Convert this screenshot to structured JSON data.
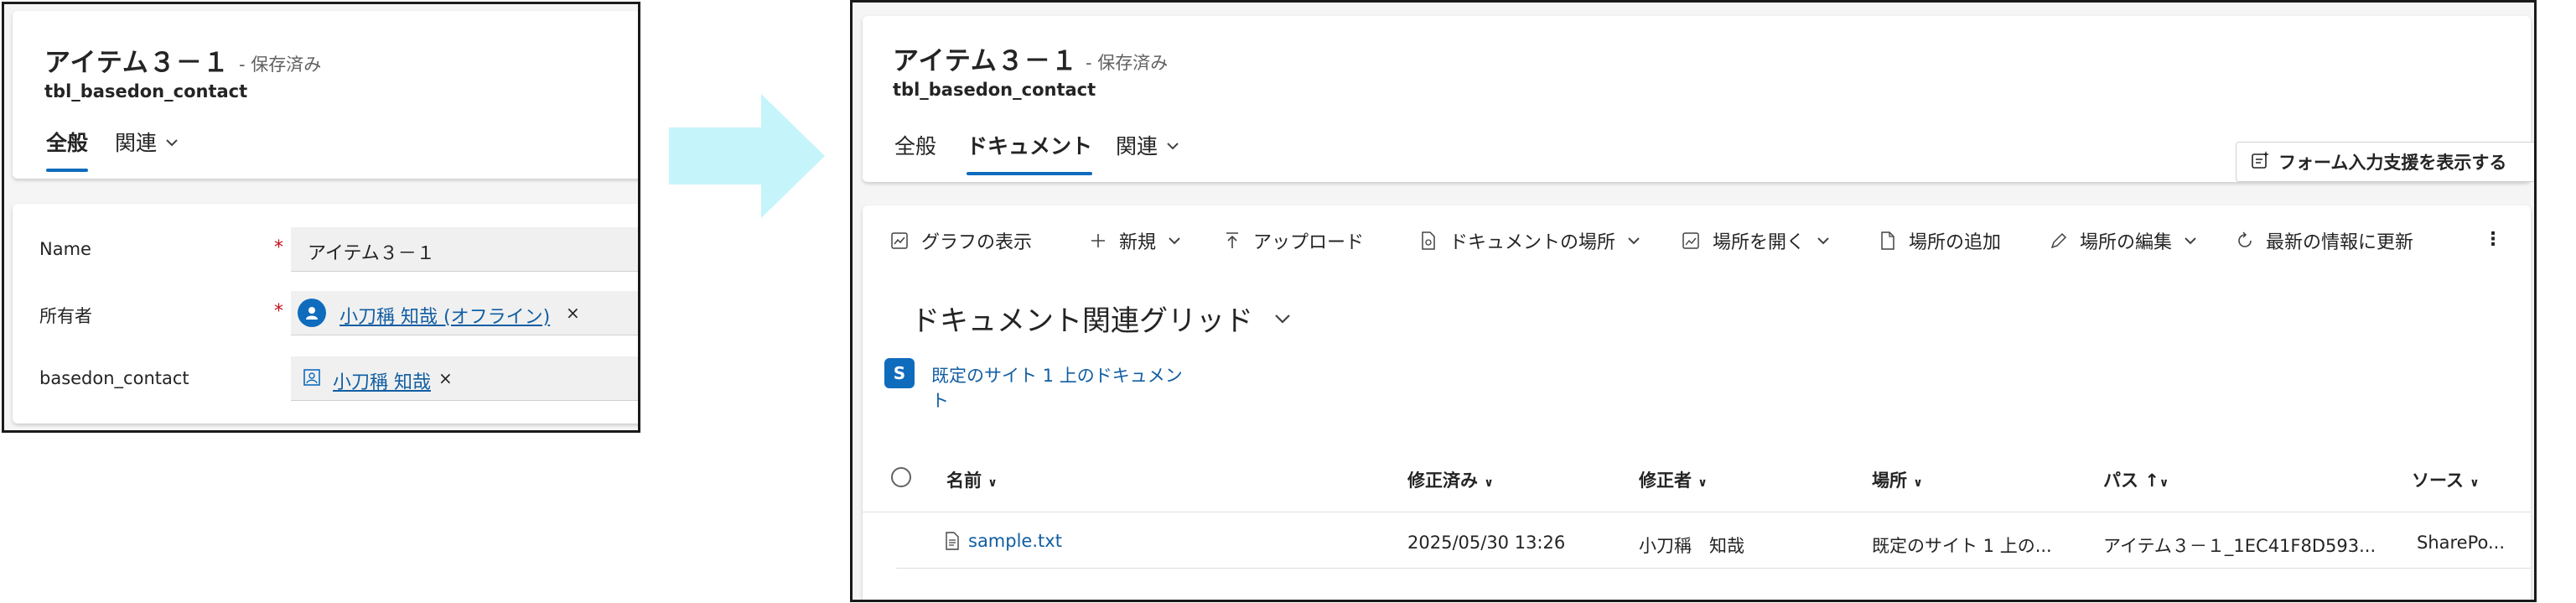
{
  "left": {
    "record_title": "アイテム３－１",
    "saved_status": "- 保存済み",
    "entity_name": "tbl_basedon_contact",
    "tabs": [
      {
        "label": "全般",
        "active": true
      },
      {
        "label": "関連",
        "active": false
      }
    ],
    "fields": {
      "name": {
        "label": "Name",
        "required": "*",
        "value": "アイテム３－１"
      },
      "owner": {
        "label": "所有者",
        "required": "*",
        "value": "小刀稱 知哉 (オフライン)",
        "remove": "×"
      },
      "basedon_contact": {
        "label": "basedon_contact",
        "value": "小刀稱 知哉",
        "remove": "×"
      }
    },
    "owner_avatar": "A"
  },
  "right": {
    "record_title": "アイテム３－１",
    "saved_status": "- 保存済み",
    "entity_name": "tbl_basedon_contact",
    "tabs": [
      {
        "label": "全般",
        "active": false
      },
      {
        "label": "ドキュメント",
        "active": true
      },
      {
        "label": "関連",
        "active": false
      }
    ],
    "form_assist_button": "フォーム入力支援を表示する",
    "toolbar": [
      {
        "label": "グラフの表示",
        "icon": "chart-icon"
      },
      {
        "label": "新規",
        "icon": "plus-icon",
        "dropdown": true
      },
      {
        "label": "アップロード",
        "icon": "upload-icon"
      },
      {
        "label": "ドキュメントの場所",
        "icon": "document-location-icon",
        "dropdown": true
      },
      {
        "label": "場所を開く",
        "icon": "open-location-icon",
        "dropdown": true
      },
      {
        "label": "場所の追加",
        "icon": "add-location-icon"
      },
      {
        "label": "場所の編集",
        "icon": "edit-icon",
        "dropdown": true
      },
      {
        "label": "最新の情報に更新",
        "icon": "refresh-icon"
      }
    ],
    "more": "⋮",
    "grid_title": "ドキュメント関連グリッド",
    "location_link_line1": "既定のサイト 1 上のドキュメン",
    "location_link_line2": "ト",
    "columns": [
      "名前",
      "修正済み",
      "修正者",
      "場所",
      "パス",
      "ソース"
    ],
    "rows": [
      {
        "name": "sample.txt",
        "modified": "2025/05/30 13:26",
        "modified_by": "小刀稱　知哉",
        "location": "既定のサイト 1 上の...",
        "path": "アイテム３－１_1EC41F8D593...",
        "source": "SharePo..."
      }
    ]
  },
  "colors": {
    "accent": "#0f6cbd",
    "arrow": "#c6f4fb",
    "required": "#c50f1f"
  }
}
